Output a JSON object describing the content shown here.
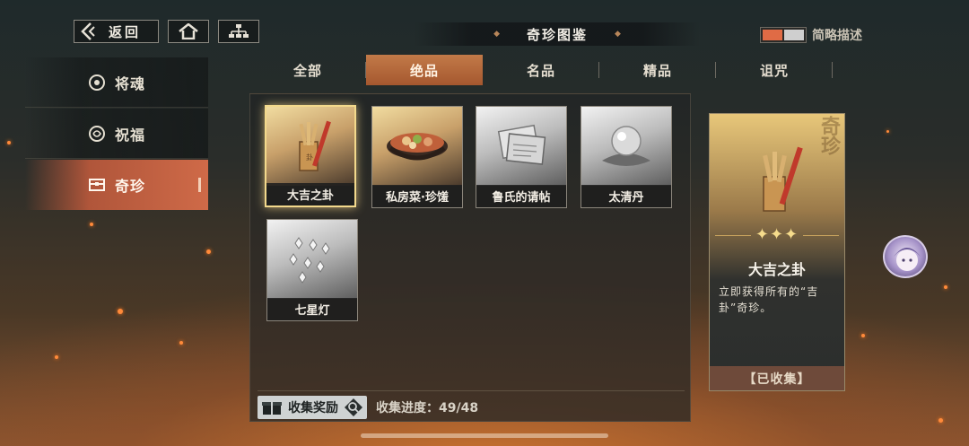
{
  "header": {
    "back_label": "返回",
    "title": "奇珍图鉴",
    "toggle_label": "简略描述"
  },
  "sidebar": {
    "items": [
      {
        "label": "将魂",
        "icon": "soul-icon",
        "active": false
      },
      {
        "label": "祝福",
        "icon": "blessing-icon",
        "active": false
      },
      {
        "label": "奇珍",
        "icon": "treasure-chest-icon",
        "active": true
      }
    ]
  },
  "tabs": [
    {
      "label": "全部",
      "active": false
    },
    {
      "label": "绝品",
      "active": true
    },
    {
      "label": "名品",
      "active": false
    },
    {
      "label": "精品",
      "active": false
    },
    {
      "label": "诅咒",
      "active": false
    }
  ],
  "items": [
    {
      "name": "大吉之卦",
      "rarity": "gold",
      "selected": true,
      "icon": "divination-sticks-icon"
    },
    {
      "name": "私房菜·珍馐",
      "rarity": "gold",
      "selected": false,
      "icon": "food-pot-icon"
    },
    {
      "name": "鲁氏的请帖",
      "rarity": "grey",
      "selected": false,
      "icon": "invitation-letter-icon"
    },
    {
      "name": "太清丹",
      "rarity": "grey",
      "selected": false,
      "icon": "crystal-orb-icon"
    },
    {
      "name": "七星灯",
      "rarity": "grey",
      "selected": false,
      "icon": "seven-star-lamps-icon"
    }
  ],
  "footer": {
    "reward_label": "收集奖励",
    "progress_label": "收集进度：49/48"
  },
  "detail": {
    "watermark": "奇珍",
    "stars": "✦✦✦",
    "name": "大吉之卦",
    "description": "立即获得所有的“吉卦”奇珍。",
    "status": "【已收集】"
  },
  "colors": {
    "accent": "#cf6a48",
    "tab_active": "#b06536",
    "gold_frame": "#f3d98c"
  }
}
